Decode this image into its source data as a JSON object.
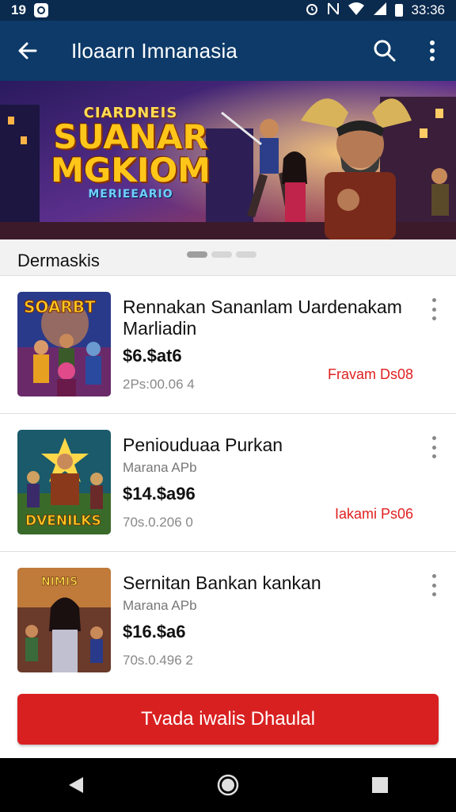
{
  "status_bar": {
    "time": "19",
    "clock": "33:36",
    "icons": [
      "app-notification-icon",
      "alarm-icon",
      "nfc-icon",
      "wifi-icon",
      "signal-icon",
      "battery-icon"
    ]
  },
  "app_bar": {
    "title": "Iloaarn Imnanasia",
    "icons": [
      "back-arrow-icon",
      "search-icon",
      "more-vert-icon"
    ]
  },
  "banner": {
    "line1": "CIARDNEIS",
    "line2": "SUANAR",
    "line3": "MGKIOM",
    "line4": "MERIEEARIO"
  },
  "section": {
    "label": "Dermaskis",
    "carousel_pages": 3,
    "active_page": 1
  },
  "items": [
    {
      "title": "Rennakan Sananlam Uardenakam Marliadin",
      "subtitle": "",
      "price": "$6.$at6",
      "meta": "2Ps:00.06 4",
      "tag": "Fravam Ds08"
    },
    {
      "title": "Peniouduaa Purkan",
      "subtitle": "Marana APb",
      "price": "$14.$a96",
      "meta": "70s.0.206 0",
      "tag": "Iakami Ps06"
    },
    {
      "title": "Sernitan Bankan kankan",
      "subtitle": "Marana APb",
      "price": "$16.$a6",
      "meta": "70s.0.496 2",
      "tag": ""
    }
  ],
  "cta": {
    "label": "Tvada iwalis Dhaulal"
  },
  "nav_bar": {
    "icons": [
      "back-triangle-icon",
      "home-circle-icon",
      "recents-square-icon"
    ]
  },
  "colors": {
    "status_bar": "#0a2a4e",
    "app_bar": "#0d3a68",
    "accent_red": "#d92020",
    "tag_red": "#e02020"
  }
}
